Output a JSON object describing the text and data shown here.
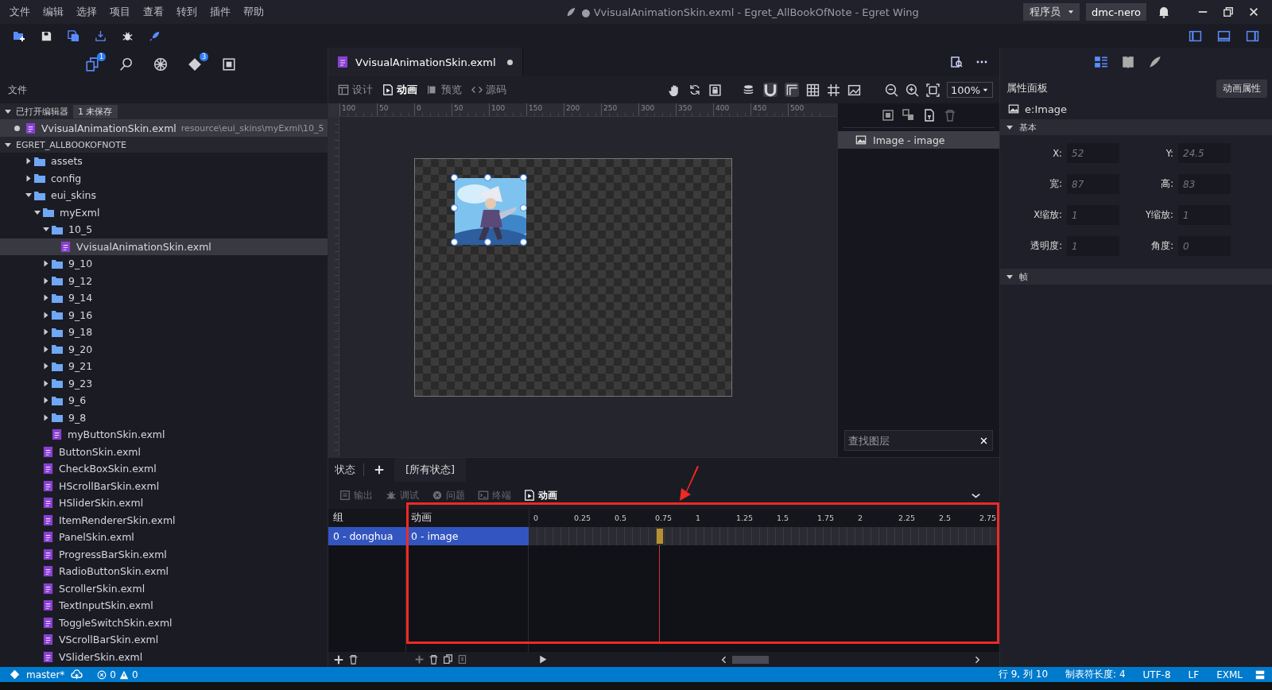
{
  "window": {
    "title": "● VvisualAnimationSkin.exml - Egret_AllBookOfNote - Egret Wing",
    "role": "程序员",
    "user": "dmc-nero"
  },
  "menu": [
    "文件",
    "编辑",
    "选择",
    "项目",
    "查看",
    "转到",
    "插件",
    "帮助"
  ],
  "activity_bar": [
    {
      "kind": "files",
      "badge": "1",
      "selected": true
    },
    {
      "kind": "search",
      "selected": false
    },
    {
      "kind": "debug",
      "selected": false
    },
    {
      "kind": "git",
      "badge": "3",
      "selected": false
    },
    {
      "kind": "extensions",
      "selected": false
    }
  ],
  "explorer": {
    "title": "文件",
    "open_editors": {
      "label": "已打开编辑器",
      "badge": "1 未保存",
      "expanded": true,
      "files": [
        {
          "name": "VvisualAnimationSkin.exml",
          "path": "resource\\eui_skins\\myExml\\10_5",
          "modified": true,
          "selected": true
        }
      ]
    },
    "project": {
      "label": "EGRET_ALLBOOKOFNOTE",
      "expanded": true,
      "children": [
        {
          "name": "assets",
          "kind": "folder",
          "expanded": false,
          "selected": false
        },
        {
          "name": "config",
          "kind": "folder",
          "expanded": false,
          "selected": false
        },
        {
          "name": "eui_skins",
          "kind": "folder",
          "expanded": true,
          "selected": false,
          "children": [
            {
              "name": "myExml",
              "kind": "folder",
              "expanded": true,
              "selected": false,
              "children": [
                {
                  "name": "10_5",
                  "kind": "folder",
                  "expanded": true,
                  "selected": false,
                  "children": [
                    {
                      "name": "VvisualAnimationSkin.exml",
                      "kind": "file",
                      "selected": true
                    }
                  ]
                },
                {
                  "name": "9_10",
                  "kind": "folder",
                  "expanded": false,
                  "selected": false
                },
                {
                  "name": "9_12",
                  "kind": "folder",
                  "expanded": false,
                  "selected": false
                },
                {
                  "name": "9_14",
                  "kind": "folder",
                  "expanded": false,
                  "selected": false
                },
                {
                  "name": "9_16",
                  "kind": "folder",
                  "expanded": false,
                  "selected": false
                },
                {
                  "name": "9_18",
                  "kind": "folder",
                  "expanded": false,
                  "selected": false
                },
                {
                  "name": "9_20",
                  "kind": "folder",
                  "expanded": false,
                  "selected": false
                },
                {
                  "name": "9_21",
                  "kind": "folder",
                  "expanded": false,
                  "selected": false
                },
                {
                  "name": "9_23",
                  "kind": "folder",
                  "expanded": false,
                  "selected": false
                },
                {
                  "name": "9_6",
                  "kind": "folder",
                  "expanded": false,
                  "selected": false
                },
                {
                  "name": "9_8",
                  "kind": "folder",
                  "expanded": false,
                  "selected": false
                },
                {
                  "name": "myButtonSkin.exml",
                  "kind": "file",
                  "selected": false
                }
              ]
            },
            {
              "name": "ButtonSkin.exml",
              "kind": "file",
              "selected": false
            },
            {
              "name": "CheckBoxSkin.exml",
              "kind": "file",
              "selected": false
            },
            {
              "name": "HScrollBarSkin.exml",
              "kind": "file",
              "selected": false
            },
            {
              "name": "HSliderSkin.exml",
              "kind": "file",
              "selected": false
            },
            {
              "name": "ItemRendererSkin.exml",
              "kind": "file",
              "selected": false
            },
            {
              "name": "PanelSkin.exml",
              "kind": "file",
              "selected": false
            },
            {
              "name": "ProgressBarSkin.exml",
              "kind": "file",
              "selected": false
            },
            {
              "name": "RadioButtonSkin.exml",
              "kind": "file",
              "selected": false
            },
            {
              "name": "ScrollerSkin.exml",
              "kind": "file",
              "selected": false
            },
            {
              "name": "TextInputSkin.exml",
              "kind": "file",
              "selected": false
            },
            {
              "name": "ToggleSwitchSkin.exml",
              "kind": "file",
              "selected": false
            },
            {
              "name": "VScrollBarSkin.exml",
              "kind": "file",
              "selected": false
            },
            {
              "name": "VSliderSkin.exml",
              "kind": "file",
              "selected": false
            }
          ]
        }
      ]
    }
  },
  "editor": {
    "tab": {
      "label": "VvisualAnimationSkin.exml",
      "modified": true
    },
    "views": [
      {
        "label": "设计",
        "kind": "design",
        "selected": false
      },
      {
        "label": "动画",
        "kind": "animation",
        "selected": true
      },
      {
        "label": "预览",
        "kind": "preview",
        "selected": false
      },
      {
        "label": "源码",
        "kind": "source",
        "selected": false
      }
    ],
    "zoom": "100%",
    "ruler": [
      "100",
      "50",
      "0",
      "50",
      "100",
      "150",
      "200",
      "250",
      "300",
      "350",
      "400",
      "450",
      "500"
    ],
    "canvas": {
      "image": {
        "kind": "picture",
        "selected": true
      }
    }
  },
  "layers": {
    "items": [
      {
        "label": "Image - image",
        "selected": true
      }
    ],
    "search": {
      "placeholder": "查找图层"
    }
  },
  "states": {
    "label": "状态",
    "tabs": [
      {
        "label": "[所有状态]",
        "selected": true
      }
    ]
  },
  "panel_tabs": [
    {
      "label": "输出",
      "kind": "output",
      "selected": false
    },
    {
      "label": "调试",
      "kind": "debug",
      "selected": false
    },
    {
      "label": "问题",
      "kind": "problems",
      "selected": false
    },
    {
      "label": "终端",
      "kind": "terminal",
      "selected": false
    },
    {
      "label": "动画",
      "kind": "animation",
      "selected": true
    }
  ],
  "timeline": {
    "group_header": "组",
    "animation_header": "动画",
    "ticks": [
      "0",
      "0.25",
      "0.5",
      "0.75",
      "1",
      "1.25",
      "1.5",
      "1.75",
      "2",
      "2.25",
      "2.5",
      "2.75"
    ],
    "groups": [
      {
        "label": "0 - donghua",
        "selected": true
      }
    ],
    "animations": [
      {
        "label": "0 - image",
        "selected": true
      }
    ]
  },
  "properties": {
    "title": "属性面板",
    "button": "动画属性",
    "element": "e:Image",
    "sections": [
      {
        "title": "基本",
        "expanded": true,
        "fields": [
          {
            "label": "X:",
            "value": "52"
          },
          {
            "label": "Y:",
            "value": "24.5"
          },
          {
            "label": "宽:",
            "value": "87"
          },
          {
            "label": "高:",
            "value": "83"
          },
          {
            "label": "X缩放:",
            "value": "1"
          },
          {
            "label": "Y缩放:",
            "value": "1"
          },
          {
            "label": "透明度:",
            "value": "1"
          },
          {
            "label": "角度:",
            "value": "0"
          }
        ]
      },
      {
        "title": "帧",
        "expanded": true
      }
    ]
  },
  "status_bar": {
    "branch": "master*",
    "errors": "0",
    "warnings": "0",
    "items": [
      "行 9, 列 10",
      "制表符长度: 4",
      "UTF-8",
      "LF",
      "EXML"
    ]
  }
}
